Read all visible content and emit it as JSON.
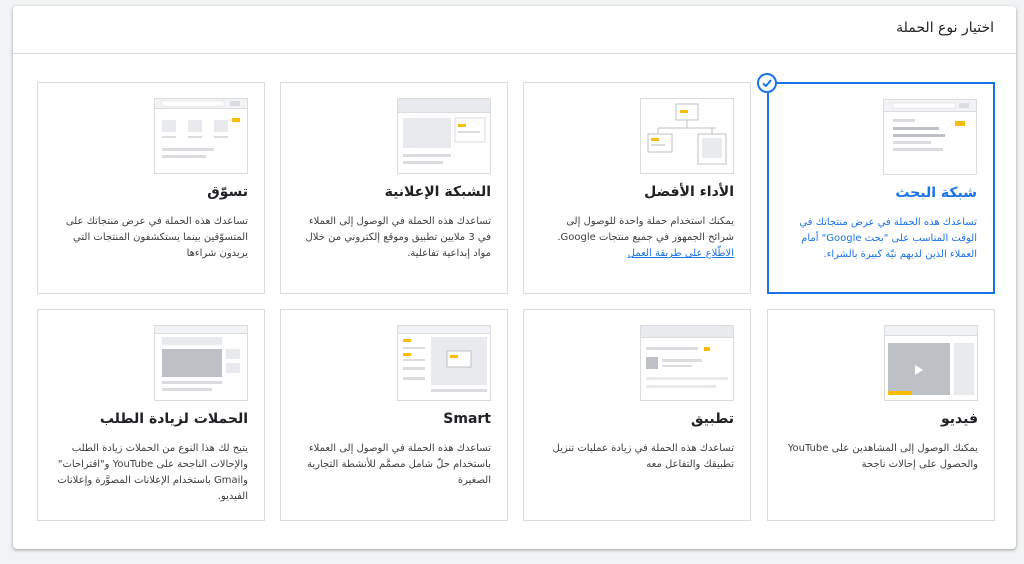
{
  "header": {
    "title": "اختيار نوع الحملة"
  },
  "colors": {
    "accent": "#1a73e8",
    "highlight": "#fbbc04",
    "border": "#dadce0"
  },
  "cards": [
    {
      "title": "شبكة البحث",
      "desc": "تساعدك هذه الحملة في عرض منتجاتك في الوقت المناسب على \"بحث Google\" أمام العملاء الذين لديهم نيّة كبيرة بالشراء.",
      "selected": true,
      "illustration": "search-network"
    },
    {
      "title": "الأداء الأفضل",
      "desc": "يمكنك استخدام حملة واحدة للوصول إلى شرائح الجمهور في جميع منتجات Google.",
      "link": "الاطّلاع على طريقة العمل",
      "selected": false,
      "illustration": "performance-max"
    },
    {
      "title": "الشبكة الإعلانية",
      "desc": "تساعدك هذه الحملة في الوصول إلى العملاء في 3 ملايين تطبيق وموقع إلكتروني من خلال مواد إبداعية تفاعلية.",
      "selected": false,
      "illustration": "display-network"
    },
    {
      "title": "تسوّق",
      "desc": "تساعدك هذه الحملة في عرض منتجاتك على المتسوّقين بينما يستكشفون المنتجات التي يريدون شراءها",
      "selected": false,
      "illustration": "shopping"
    },
    {
      "title": "فيديو",
      "desc": "يمكنك الوصول إلى المشاهدين على YouTube والحصول على إحالات ناجحة",
      "selected": false,
      "illustration": "video"
    },
    {
      "title": "تطبيق",
      "desc": "تساعدك هذه الحملة في زيادة عمليات تنزيل تطبيقك والتفاعل معه",
      "selected": false,
      "illustration": "app"
    },
    {
      "title": "Smart",
      "desc": "تساعدك هذه الحملة في الوصول إلى العملاء باستخدام حلّ شامل مصمَّم للأنشطة التجارية الصغيرة",
      "selected": false,
      "illustration": "smart"
    },
    {
      "title": "الحملات لزيادة الطلب",
      "desc": "يتيح لك هذا النوع من الحملات زيادة الطلب والإحالات الناجحة على YouTube و\"اقتراحات\" وGmail باستخدام الإعلانات المصوَّرة وإعلانات الفيديو.",
      "selected": false,
      "illustration": "demand-gen"
    }
  ]
}
